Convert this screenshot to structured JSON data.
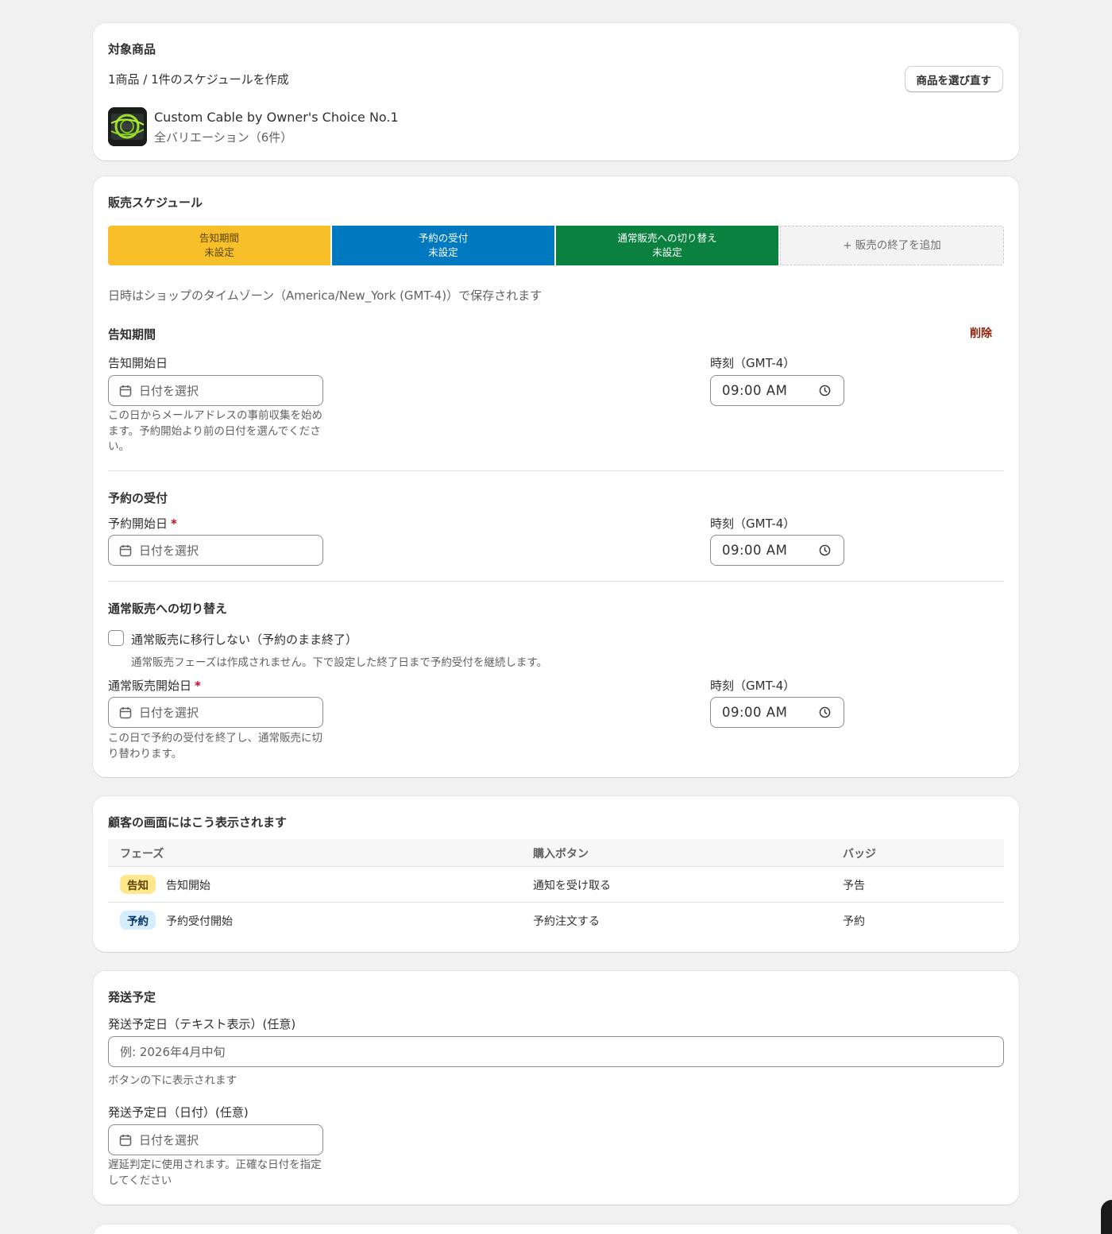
{
  "product": {
    "title": "対象商品",
    "summary": "1商品 / 1件のスケジュールを作成",
    "reselect_label": "商品を選び直す",
    "name": "Custom Cable by Owner's Choice No.1",
    "variants": "全バリエーション（6件）"
  },
  "schedule": {
    "title": "販売スケジュール",
    "phases": [
      {
        "name": "告知期間",
        "status": "未設定",
        "color": "#f7bf2a"
      },
      {
        "name": "予約の受付",
        "status": "未設定",
        "color": "#0079c0"
      },
      {
        "name": "通常販売への切り替え",
        "status": "未設定",
        "color": "#0b8140"
      }
    ],
    "add_end_label": "+ 販売の終了を追加",
    "timezone_note": "日時はショップのタイムゾーン（America/New_York (GMT-4)）で保存されます",
    "announce": {
      "heading": "告知期間",
      "delete_label": "削除",
      "date_label": "告知開始日",
      "date_placeholder": "日付を選択",
      "time_label": "時刻（GMT-4）",
      "time_value": "09:00 AM",
      "help": "この日からメールアドレスの事前収集を始めます。予約開始より前の日付を選んでください。"
    },
    "preorder": {
      "heading": "予約の受付",
      "date_label": "予約開始日",
      "required_mark": "*",
      "date_placeholder": "日付を選択",
      "time_label": "時刻（GMT-4）",
      "time_value": "09:00 AM"
    },
    "regular": {
      "heading": "通常販売への切り替え",
      "checkbox_label": "通常販売に移行しない（予約のまま終了）",
      "checkbox_help": "通常販売フェーズは作成されません。下で設定した終了日まで予約受付を継続します。",
      "date_label": "通常販売開始日",
      "required_mark": "*",
      "date_placeholder": "日付を選択",
      "time_label": "時刻（GMT-4）",
      "time_value": "09:00 AM",
      "help": "この日で予約の受付を終了し、通常販売に切り替わります。"
    }
  },
  "preview": {
    "title": "顧客の画面にはこう表示されます",
    "columns": [
      "フェーズ",
      "購入ボタン",
      "バッジ"
    ],
    "rows": [
      {
        "badge": "告知",
        "phase": "告知開始",
        "button": "通知を受け取る",
        "badge_text": "予告"
      },
      {
        "badge": "予約",
        "phase": "予約受付開始",
        "button": "予約注文する",
        "badge_text": "予約"
      }
    ]
  },
  "shipping": {
    "title": "発送予定",
    "text_label": "発送予定日（テキスト表示）(任意)",
    "text_placeholder": "例: 2026年4月中旬",
    "text_help": "ボタンの下に表示されます",
    "date_label": "発送予定日（日付）(任意)",
    "date_placeholder": "日付を選択",
    "date_help": "遅延判定に使用されます。正確な日付を指定してください"
  }
}
